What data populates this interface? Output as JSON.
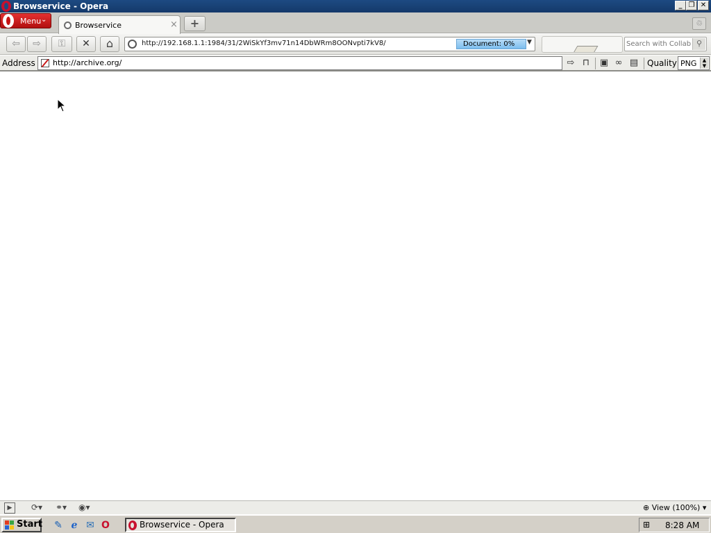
{
  "window": {
    "title": "Browservice - Opera",
    "minimize_glyph": "_",
    "restore_glyph": "❐",
    "close_glyph": "✕"
  },
  "tabstrip": {
    "menu_label": "Menu",
    "menu_chevron": "⌄",
    "tabs": [
      {
        "label": "Browservice",
        "close_glyph": "×"
      }
    ],
    "new_tab_glyph": "+",
    "trash_glyph": "♲"
  },
  "navbar": {
    "back_glyph": "⇦",
    "forward_glyph": "⇨",
    "key_glyph": "⚿",
    "stop_glyph": "✕",
    "home_glyph": "⌂",
    "url": "http://192.168.1.1:1984/31/2WiSkYf3mv71n14DbWRm8OONvpti7kV8/",
    "progress_text": "Document:   0%",
    "dropdown_glyph": "▼",
    "search_placeholder": "Search with Collab'",
    "search_icon": "search-icon"
  },
  "addressbar": {
    "label": "Address",
    "url": "http://archive.org/",
    "quality_label": "Quality",
    "quality_value": "PNG",
    "go_glyph": "⇨",
    "bookmark_glyph": "🔖",
    "icons": [
      "save-icon",
      "find-icon",
      "clipboard-icon"
    ]
  },
  "statusbar": {
    "zoom_text": "View (100%)",
    "zoom_chevron": "▾"
  },
  "taskbar": {
    "start_label": "Start",
    "task_label": "Browservice - Opera",
    "clock": "8:28 AM"
  }
}
